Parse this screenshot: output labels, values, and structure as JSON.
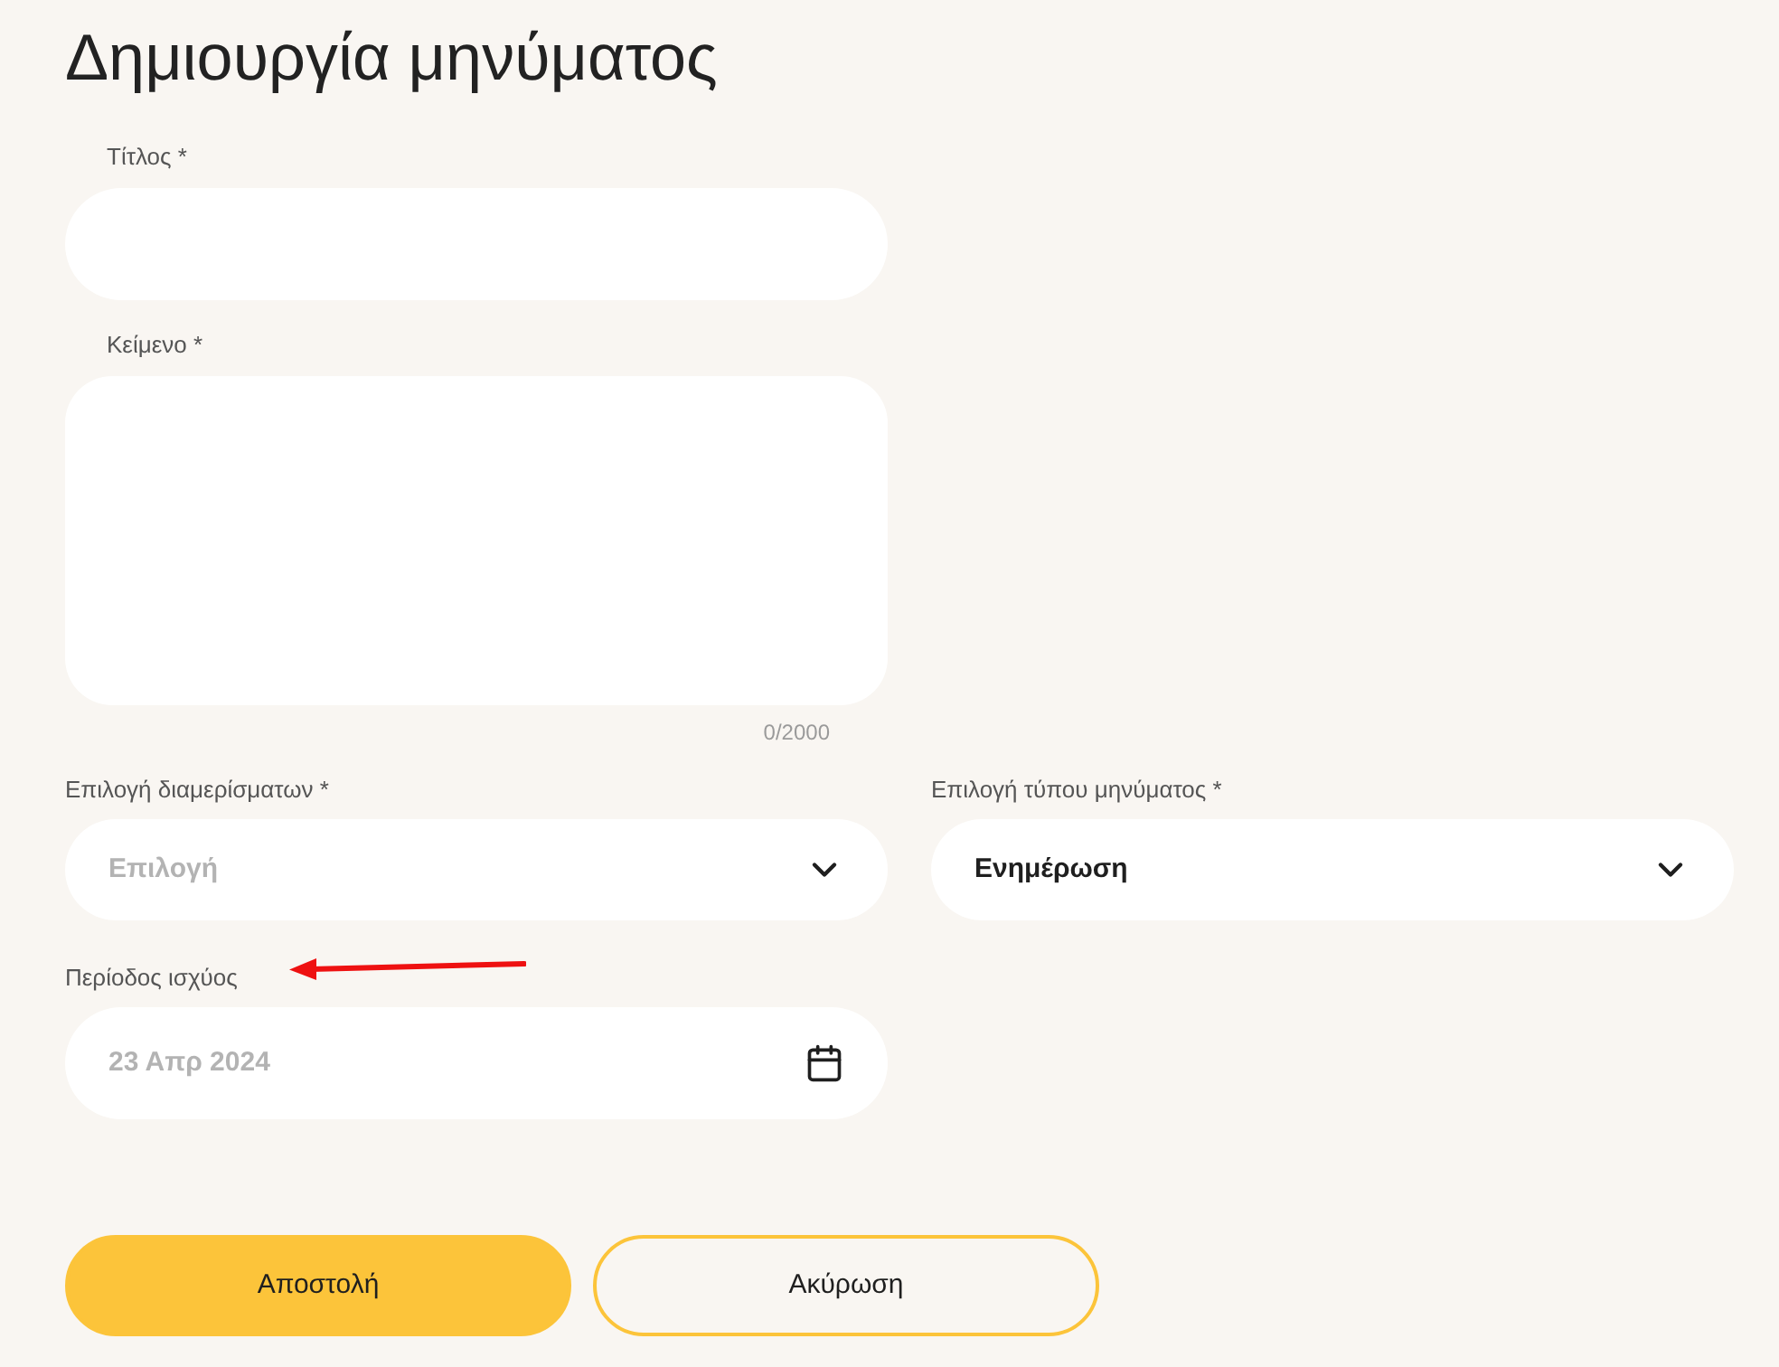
{
  "page": {
    "title": "Δημιουργία μηνύματος"
  },
  "form": {
    "title_field": {
      "label": "Τίτλος *"
    },
    "body_field": {
      "label": "Κείμενο *",
      "counter": "0/2000"
    },
    "selects": [
      {
        "label": "Επιλογή διαμερίσματων *",
        "placeholder": "Επιλογή"
      },
      {
        "label": "Επιλογή τύπου μηνύματος *",
        "value": "Ενημέρωση"
      }
    ],
    "validity_period": {
      "label": "Περίοδος ισχύος",
      "placeholder": "23 Απρ 2024"
    }
  },
  "buttons": [
    {
      "label": "Αποστολή",
      "kind": "primary"
    },
    {
      "label": "Ακύρωση",
      "kind": "secondary"
    }
  ]
}
